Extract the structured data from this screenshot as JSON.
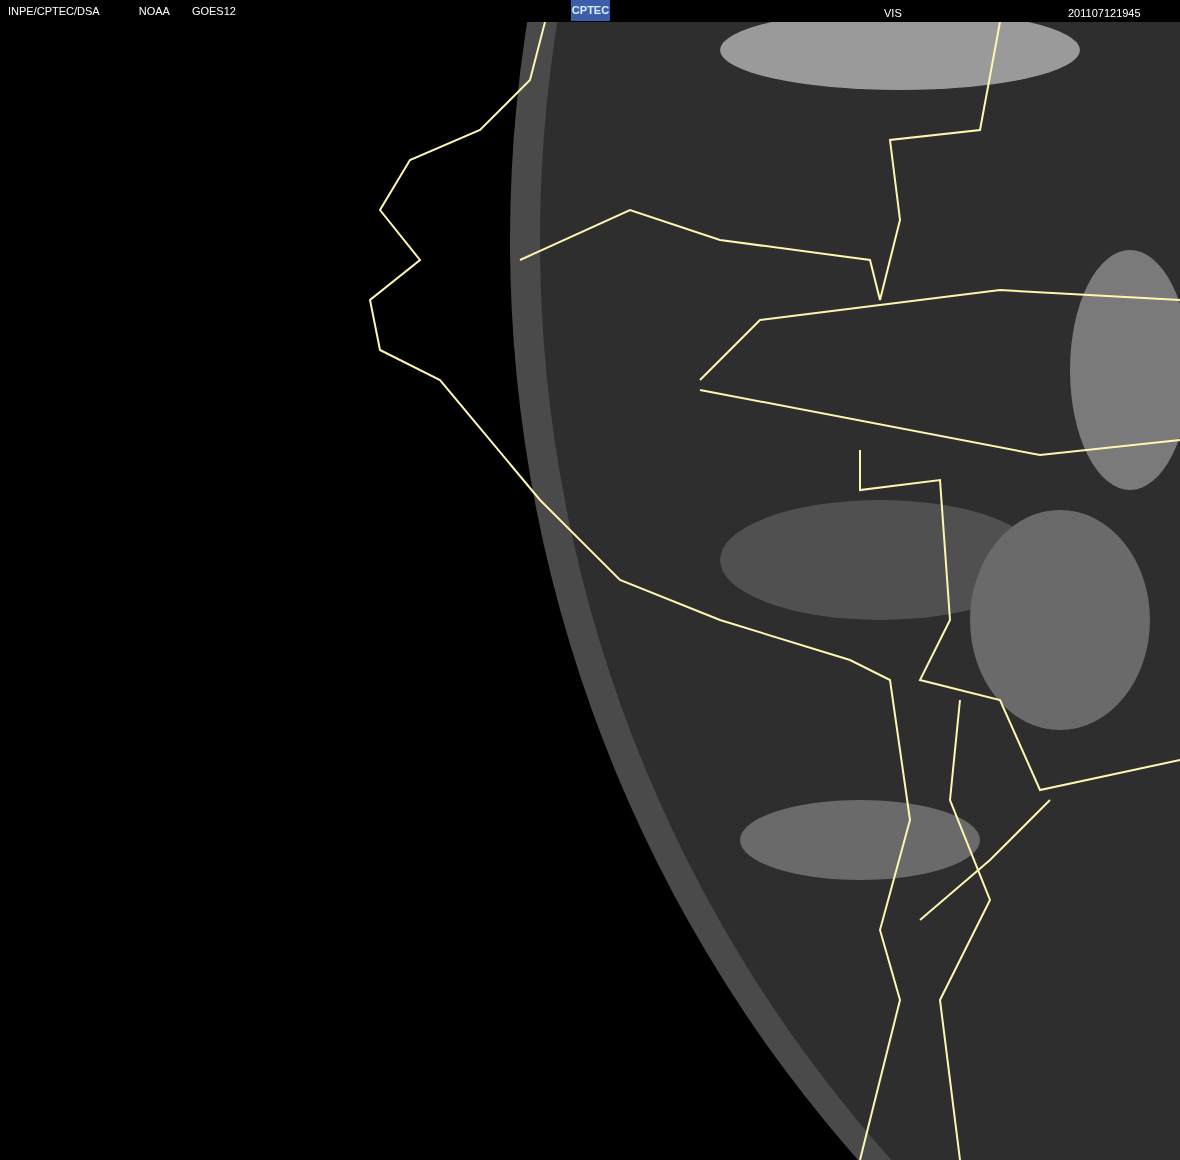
{
  "header": {
    "source": "INPE/CPTEC/DSA",
    "agency": "NOAA",
    "satellite": "GOES12",
    "logo": "CPTEC",
    "channel": "VIS",
    "timestamp": "201107121945"
  }
}
